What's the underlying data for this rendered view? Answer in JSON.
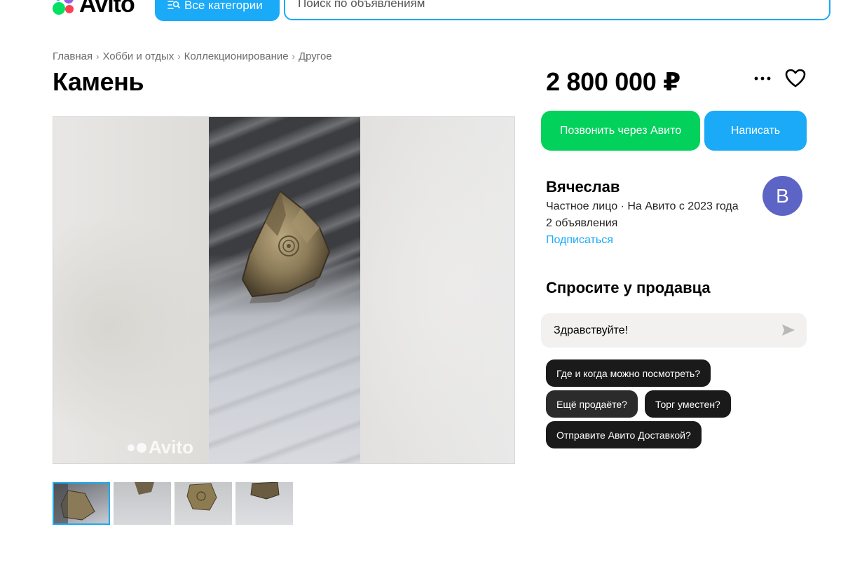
{
  "header": {
    "logo_text": "Avito",
    "categories_button": "Все категории",
    "categories_icon": "search-list-icon",
    "search_placeholder": "Поиск по объявлениям"
  },
  "breadcrumbs": [
    "Главная",
    "Хобби и отдых",
    "Коллекционирование",
    "Другое"
  ],
  "listing": {
    "title": "Камень",
    "price": "2 800 000 ₽",
    "watermark": "Avito",
    "thumbnails_count": 4,
    "active_thumbnail": 0
  },
  "actions": {
    "more_icon": "more-dots-icon",
    "favorite_icon": "heart-icon",
    "call_button": "Позвонить через Авито",
    "write_button": "Написать"
  },
  "seller": {
    "name": "Вячеслав",
    "info": "Частное лицо · На Авито с 2023 года",
    "ads_count": "2 объявления",
    "subscribe": "Подписаться",
    "avatar_letter": "В"
  },
  "ask": {
    "title": "Спросите у продавца",
    "message_value": "Здравствуйте!",
    "send_icon": "send-icon",
    "quick_questions": [
      "Где и когда можно посмотреть?",
      "Ещё продаёте?",
      "Торг уместен?",
      "Отправите Авито Доставкой?"
    ]
  },
  "colors": {
    "brand_blue": "#1aaaf7",
    "call_green": "#02d15c",
    "avatar_bg": "#5c64c6",
    "chip_bg": "#1a1a1a"
  }
}
